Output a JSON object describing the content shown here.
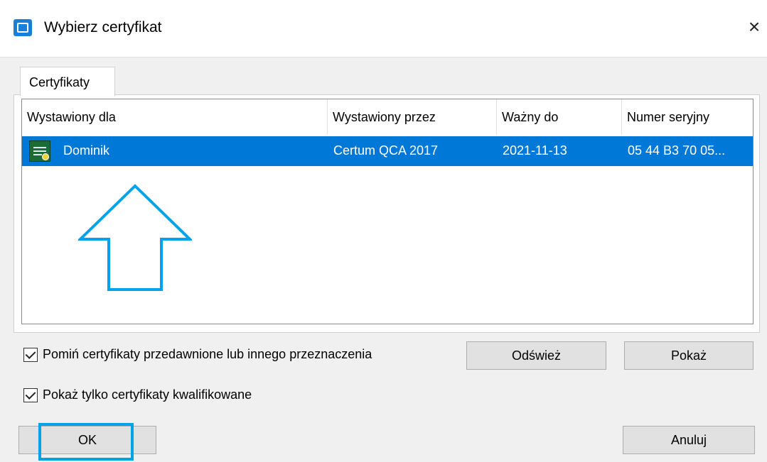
{
  "window": {
    "title": "Wybierz certyfikat",
    "close_label": "×"
  },
  "tabs": [
    {
      "label": "Certyfikaty"
    }
  ],
  "list": {
    "columns": [
      "Wystawiony dla",
      "Wystawiony przez",
      "Ważny do",
      "Numer seryjny"
    ],
    "rows": [
      {
        "issued_to": "Dominik",
        "issued_by": "Certum QCA 2017",
        "valid_to": "2021-11-13",
        "serial": "05 44 B3 70 05...",
        "selected": true,
        "icon": "certificate-icon"
      }
    ]
  },
  "options": {
    "skip_expired": {
      "label": "Pomiń certyfikaty przedawnione lub innego przeznaczenia",
      "checked": true
    },
    "qualified_only": {
      "label": "Pokaż tylko certyfikaty kwalifikowane",
      "checked": true
    }
  },
  "buttons": {
    "refresh": "Odśwież",
    "show": "Pokaż",
    "ok": "OK",
    "cancel": "Anuluj"
  },
  "annotations": {
    "arrow_icon": "up-arrow-icon",
    "highlight_color": "#00a2e8",
    "selection_color": "#0078d7"
  }
}
